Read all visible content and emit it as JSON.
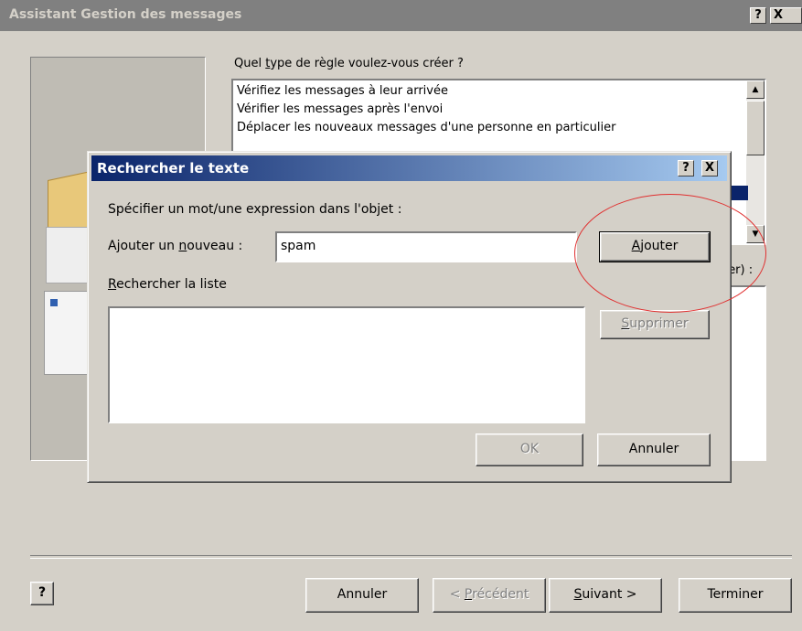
{
  "wizard": {
    "title": "Assistant Gestion des messages",
    "help_btn": "?",
    "close_btn": "X",
    "question_pre": "Quel ",
    "question_ul": "t",
    "question_post": "ype de règle voulez-vous créer ?",
    "rules": [
      "Vérifiez les messages à leur arrivée",
      "Vérifier les messages après l'envoi",
      "Déplacer les nouveaux messages d'une personne en particulier"
    ],
    "desc_label_fragment": "fier) :",
    "buttons": {
      "help": "?",
      "cancel": "Annuler",
      "prev_pre": "< ",
      "prev_ul": "P",
      "prev_post": "récédent",
      "next_ul": "S",
      "next_post": "uivant >",
      "finish": "Terminer"
    }
  },
  "dialog": {
    "title": "Rechercher le texte",
    "help_btn": "?",
    "close_btn": "X",
    "specify_label": "Spécifier un mot/une expression dans l'objet :",
    "add_label_pre": "Ajouter un ",
    "add_label_ul": "n",
    "add_label_post": "ouveau :",
    "input_value": "spam",
    "add_btn_ul": "A",
    "add_btn_post": "jouter",
    "list_label_ul": "R",
    "list_label_post": "echercher la liste",
    "delete_btn_ul": "S",
    "delete_btn_post": "upprimer",
    "ok_btn": "OK",
    "cancel_btn": "Annuler"
  }
}
